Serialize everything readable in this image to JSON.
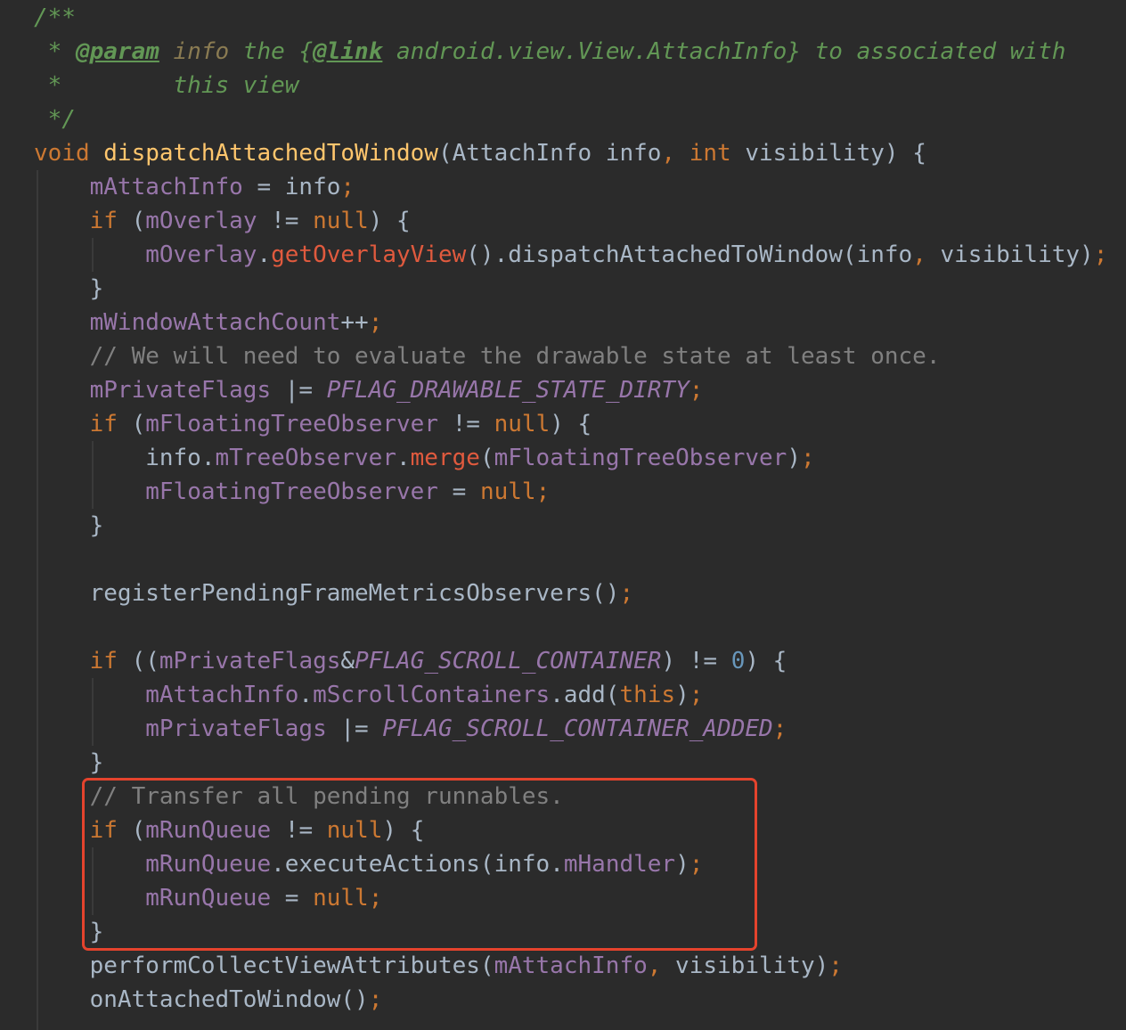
{
  "editor": {
    "theme": {
      "background": "#2B2B2B",
      "plain": "#A9B7C6",
      "keyword": "#CC7832",
      "punctuation": "#CC7832",
      "field": "#9876AA",
      "constant": "#9876AA",
      "method_declaration": "#FFC66D",
      "method_highlight": "#E05A3E",
      "number": "#6897BB",
      "line_comment": "#808080",
      "doc_comment": "#629755",
      "doc_tag": "#629755",
      "doc_param": "#8A7B52",
      "highlight_box": "#E5432D"
    },
    "lines": [
      [
        {
          "doc_comment": "/**"
        }
      ],
      [
        {
          "doc_comment": " * "
        },
        {
          "doc_tag": "@param"
        },
        {
          "doc_comment": " "
        },
        {
          "doc_param": "info"
        },
        {
          "doc_comment": " the {"
        },
        {
          "doc_tag": "@link"
        },
        {
          "doc_comment": " android.view.View.AttachInfo} to associated with"
        }
      ],
      [
        {
          "doc_comment": " *        this view"
        }
      ],
      [
        {
          "doc_comment": " */"
        }
      ],
      [
        {
          "keyword": "void"
        },
        {
          "plain": " "
        },
        {
          "method_declaration": "dispatchAttachedToWindow"
        },
        {
          "plain": "(AttachInfo info"
        },
        {
          "punctuation": ","
        },
        {
          "plain": " "
        },
        {
          "keyword": "int"
        },
        {
          "plain": " visibility) {"
        }
      ],
      [
        {
          "plain": "    "
        },
        {
          "field": "mAttachInfo"
        },
        {
          "plain": " = info"
        },
        {
          "punctuation": ";"
        }
      ],
      [
        {
          "plain": "    "
        },
        {
          "keyword": "if"
        },
        {
          "plain": " ("
        },
        {
          "field": "mOverlay"
        },
        {
          "plain": " != "
        },
        {
          "keyword": "null"
        },
        {
          "plain": ") {"
        }
      ],
      [
        {
          "plain": "        "
        },
        {
          "field": "mOverlay"
        },
        {
          "plain": "."
        },
        {
          "method_highlight": "getOverlayView"
        },
        {
          "plain": "().dispatchAttachedToWindow(info"
        },
        {
          "punctuation": ","
        },
        {
          "plain": " visibility)"
        },
        {
          "punctuation": ";"
        }
      ],
      [
        {
          "plain": "    }"
        }
      ],
      [
        {
          "plain": "    "
        },
        {
          "field": "mWindowAttachCount"
        },
        {
          "plain": "++"
        },
        {
          "punctuation": ";"
        }
      ],
      [
        {
          "plain": "    "
        },
        {
          "line_comment": "// We will need to evaluate the drawable state at least once."
        }
      ],
      [
        {
          "plain": "    "
        },
        {
          "field": "mPrivateFlags"
        },
        {
          "plain": " |= "
        },
        {
          "constant": "PFLAG_DRAWABLE_STATE_DIRTY"
        },
        {
          "punctuation": ";"
        }
      ],
      [
        {
          "plain": "    "
        },
        {
          "keyword": "if"
        },
        {
          "plain": " ("
        },
        {
          "field": "mFloatingTreeObserver"
        },
        {
          "plain": " != "
        },
        {
          "keyword": "null"
        },
        {
          "plain": ") {"
        }
      ],
      [
        {
          "plain": "        info."
        },
        {
          "field": "mTreeObserver"
        },
        {
          "plain": "."
        },
        {
          "method_highlight": "merge"
        },
        {
          "plain": "("
        },
        {
          "field": "mFloatingTreeObserver"
        },
        {
          "plain": ")"
        },
        {
          "punctuation": ";"
        }
      ],
      [
        {
          "plain": "        "
        },
        {
          "field": "mFloatingTreeObserver"
        },
        {
          "plain": " = "
        },
        {
          "keyword": "null"
        },
        {
          "punctuation": ";"
        }
      ],
      [
        {
          "plain": "    }"
        }
      ],
      [],
      [
        {
          "plain": "    registerPendingFrameMetricsObservers()"
        },
        {
          "punctuation": ";"
        }
      ],
      [],
      [
        {
          "plain": "    "
        },
        {
          "keyword": "if"
        },
        {
          "plain": " (("
        },
        {
          "field": "mPrivateFlags"
        },
        {
          "plain": "&"
        },
        {
          "constant": "PFLAG_SCROLL_CONTAINER"
        },
        {
          "plain": ") != "
        },
        {
          "number": "0"
        },
        {
          "plain": ") {"
        }
      ],
      [
        {
          "plain": "        "
        },
        {
          "field": "mAttachInfo"
        },
        {
          "plain": "."
        },
        {
          "field": "mScrollContainers"
        },
        {
          "plain": ".add("
        },
        {
          "keyword": "this"
        },
        {
          "plain": ")"
        },
        {
          "punctuation": ";"
        }
      ],
      [
        {
          "plain": "        "
        },
        {
          "field": "mPrivateFlags"
        },
        {
          "plain": " |= "
        },
        {
          "constant": "PFLAG_SCROLL_CONTAINER_ADDED"
        },
        {
          "punctuation": ";"
        }
      ],
      [
        {
          "plain": "    }"
        }
      ],
      [
        {
          "plain": "    "
        },
        {
          "line_comment": "// Transfer all pending runnables."
        }
      ],
      [
        {
          "plain": "    "
        },
        {
          "keyword": "if"
        },
        {
          "plain": " ("
        },
        {
          "field": "mRunQueue"
        },
        {
          "plain": " != "
        },
        {
          "keyword": "null"
        },
        {
          "plain": ") {"
        }
      ],
      [
        {
          "plain": "        "
        },
        {
          "field": "mRunQueue"
        },
        {
          "plain": ".executeActions(info."
        },
        {
          "field": "mHandler"
        },
        {
          "plain": ")"
        },
        {
          "punctuation": ";"
        }
      ],
      [
        {
          "plain": "        "
        },
        {
          "field": "mRunQueue"
        },
        {
          "plain": " = "
        },
        {
          "keyword": "null"
        },
        {
          "punctuation": ";"
        }
      ],
      [
        {
          "plain": "    }"
        }
      ],
      [
        {
          "plain": "    performCollectViewAttributes("
        },
        {
          "field": "mAttachInfo"
        },
        {
          "punctuation": ","
        },
        {
          "plain": " visibility)"
        },
        {
          "punctuation": ";"
        }
      ],
      [
        {
          "plain": "    onAttachedToWindow()"
        },
        {
          "punctuation": ";"
        }
      ]
    ]
  }
}
